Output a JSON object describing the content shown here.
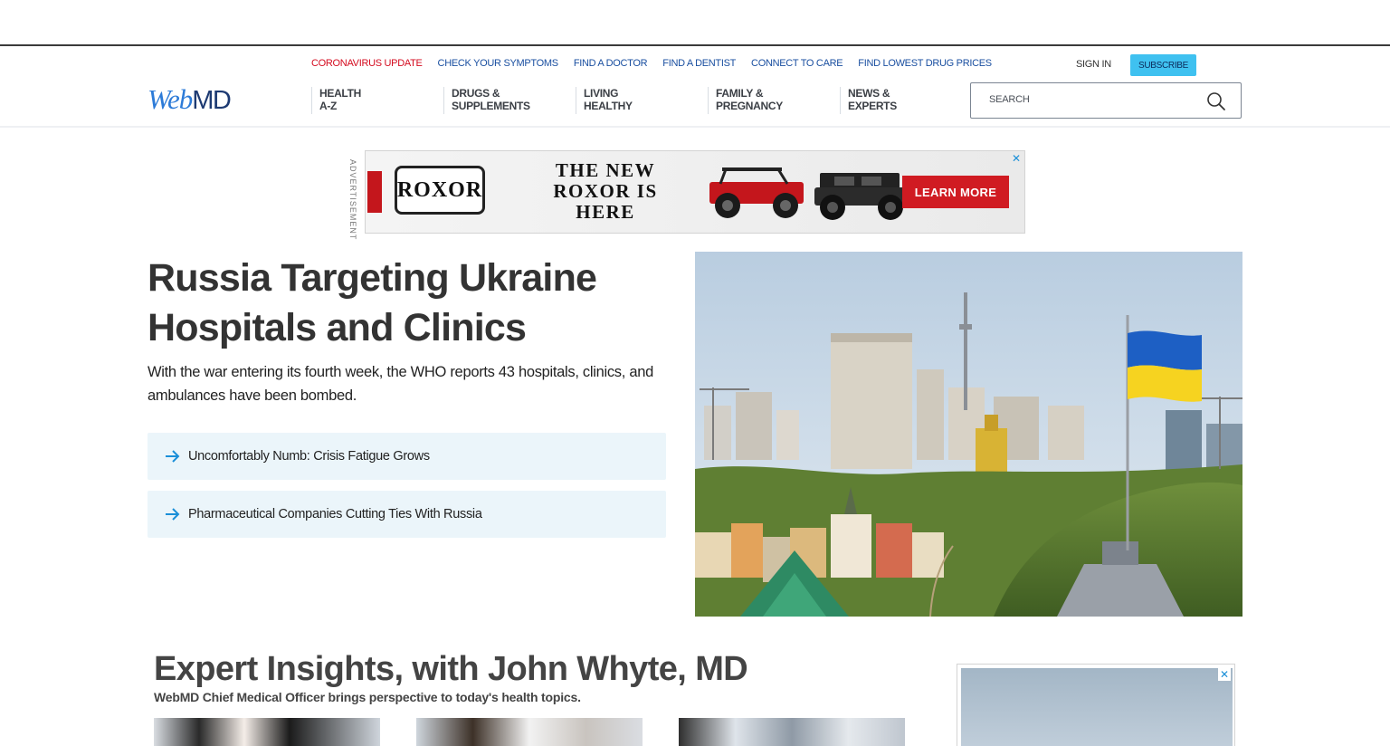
{
  "header": {
    "utility_links": [
      {
        "label": "CORONAVIRUS UPDATE",
        "alert": true
      },
      {
        "label": "CHECK YOUR SYMPTOMS",
        "alert": false
      },
      {
        "label": "FIND A DOCTOR",
        "alert": false
      },
      {
        "label": "FIND A DENTIST",
        "alert": false
      },
      {
        "label": "CONNECT TO CARE",
        "alert": false
      },
      {
        "label": "FIND LOWEST DRUG PRICES",
        "alert": false
      }
    ],
    "sign_in": "SIGN IN",
    "subscribe": "SUBSCRIBE",
    "logo": {
      "web": "Web",
      "md": "MD"
    },
    "nav": [
      {
        "label": "HEALTH\nA-Z"
      },
      {
        "label": "DRUGS &\nSUPPLEMENTS"
      },
      {
        "label": "LIVING\nHEALTHY"
      },
      {
        "label": "FAMILY &\nPREGNANCY"
      },
      {
        "label": "NEWS &\nEXPERTS"
      }
    ],
    "search": {
      "placeholder": "SEARCH",
      "icon": "search-icon"
    }
  },
  "ad_banner": {
    "label": "ADVERTISEMENT",
    "brand": "ROXOR",
    "headline": "THE NEW ROXOR IS HERE",
    "cta": "LEARN MORE",
    "close": "✕",
    "cta_color": "#d01b22"
  },
  "hero": {
    "title": "Russia Targeting Ukraine Hospitals and Clinics",
    "dek": "With the war entering its fourth week, the WHO reports 43 hospitals, clinics, and ambulances have been bombed.",
    "related": [
      {
        "label": "Uncomfortably Numb: Crisis Fatigue Grows"
      },
      {
        "label": "Pharmaceutical Companies Cutting Ties With Russia"
      }
    ]
  },
  "insights": {
    "title": "Expert Insights, with John Whyte, MD",
    "subtitle": "WebMD Chief Medical Officer brings perspective to today's health topics."
  },
  "side_ad": {
    "close": "✕"
  },
  "colors": {
    "brand_blue": "#2d7bd8",
    "brand_navy": "#1d3a72",
    "link_blue": "#1a4fa0",
    "alert_red": "#d40b1f",
    "subscribe": "#3fc1f0",
    "related_bg": "#ebf5fa"
  }
}
